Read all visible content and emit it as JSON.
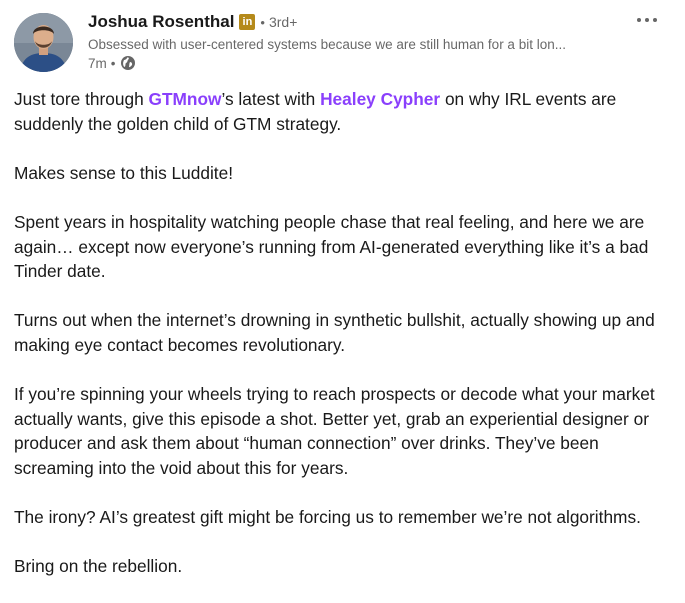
{
  "author": {
    "name": "Joshua Rosenthal",
    "badge": "in",
    "dot": "•",
    "degree": "3rd+",
    "headline": "Obsessed with user-centered systems because we are still human for a bit lon...",
    "timestamp": "7m",
    "visibility_dot": "•",
    "visibility_icon": "globe-icon"
  },
  "menu": {
    "icon": "more-horizontal-icon"
  },
  "post": {
    "line1_start": "Just tore through ",
    "mention1": "GTMnow",
    "line1_mid": "’s latest with ",
    "mention2": "Healey Cypher",
    "line1_end": " on why IRL events are suddenly the golden child of GTM strategy.",
    "p2": "Makes sense to this Luddite!",
    "p3": "Spent years in hospitality watching people chase that real feeling, and here we are again… except now everyone’s running from AI-generated everything like it’s a bad Tinder date.",
    "p4": "Turns out when the internet’s drowning in synthetic bullshit, actually showing up and making eye contact becomes revolutionary.",
    "p5": "If you’re spinning your wheels trying to reach prospects or decode what your market actually wants, give this episode a shot. Better yet, grab an experiential designer or producer and ask them about “human connection” over drinks. They’ve been screaming into the void about this for years.",
    "p6": "The irony? AI’s greatest gift might be forcing us to remember we’re not algorithms.",
    "p7": "Bring on the rebellion."
  },
  "colors": {
    "mention": "#8a3ffc",
    "badge": "#b58a1a",
    "secondary_text": "#666666"
  }
}
